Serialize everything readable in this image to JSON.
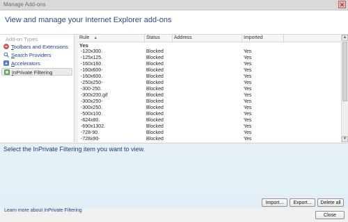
{
  "window": {
    "title": "Manage Add-ons",
    "close_symbol": "✕"
  },
  "header": {
    "heading": "View and manage your Internet Explorer add-ons"
  },
  "sidebar": {
    "types_label": "Add-on Types",
    "items": [
      {
        "label": "Toolbars and Extensions",
        "icon": "toolbars-icon",
        "selected": false
      },
      {
        "label": "Search Providers",
        "icon": "search-icon",
        "selected": false
      },
      {
        "label": "Accelerators",
        "icon": "accelerators-icon",
        "selected": false
      },
      {
        "label": "InPrivate Filtering",
        "icon": "inprivate-icon",
        "selected": true
      }
    ]
  },
  "table": {
    "columns": [
      {
        "key": "rule",
        "label": "Rule",
        "sort_indicator": "▲"
      },
      {
        "key": "status",
        "label": "Status"
      },
      {
        "key": "address",
        "label": "Address"
      },
      {
        "key": "imported",
        "label": "Imported"
      }
    ],
    "group_label": "Yes",
    "rows": [
      {
        "rule": "-120x300.",
        "status": "Blocked",
        "address": "",
        "imported": "Yes"
      },
      {
        "rule": "-125x125.",
        "status": "Blocked",
        "address": "",
        "imported": "Yes"
      },
      {
        "rule": "-160x160.",
        "status": "Blocked",
        "address": "",
        "imported": "Yes"
      },
      {
        "rule": "-160x600-",
        "status": "Blocked",
        "address": "",
        "imported": "Yes"
      },
      {
        "rule": "-160x600.",
        "status": "Blocked",
        "address": "",
        "imported": "Yes"
      },
      {
        "rule": "-250x250-",
        "status": "Blocked",
        "address": "",
        "imported": "Yes"
      },
      {
        "rule": "-300-250.",
        "status": "Blocked",
        "address": "",
        "imported": "Yes"
      },
      {
        "rule": "-300x200.gif",
        "status": "Blocked",
        "address": "",
        "imported": "Yes"
      },
      {
        "rule": "-300x250-",
        "status": "Blocked",
        "address": "",
        "imported": "Yes"
      },
      {
        "rule": "-300x250.",
        "status": "Blocked",
        "address": "",
        "imported": "Yes"
      },
      {
        "rule": "-500x100.",
        "status": "Blocked",
        "address": "",
        "imported": "Yes"
      },
      {
        "rule": "-624x80.",
        "status": "Blocked",
        "address": "",
        "imported": "Yes"
      },
      {
        "rule": "-690x1302.",
        "status": "Blocked",
        "address": "",
        "imported": "Yes"
      },
      {
        "rule": "-728-90.",
        "status": "Blocked",
        "address": "",
        "imported": "Yes"
      },
      {
        "rule": "-728x90-",
        "status": "Blocked",
        "address": "",
        "imported": "Yes"
      }
    ]
  },
  "details": {
    "prompt": "Select the InPrivate Filtering item you want to view."
  },
  "buttons": {
    "import": "Import...",
    "export": "Export...",
    "delete_all": "Delete all",
    "close": "Close"
  },
  "footer": {
    "learn_more": "Learn more about InPrivate Filtering"
  }
}
